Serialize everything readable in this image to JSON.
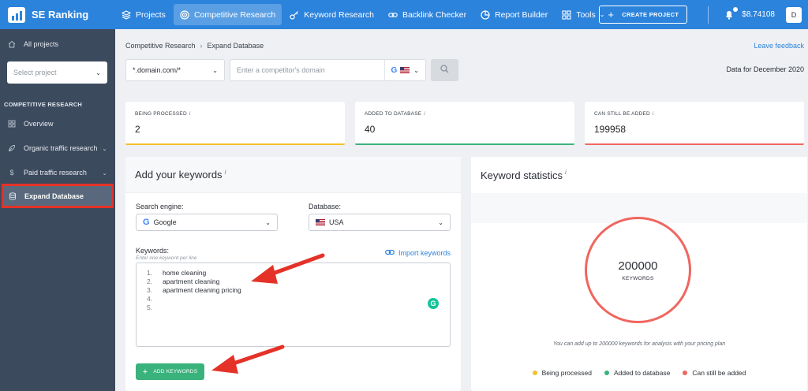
{
  "brand": {
    "name": "SE Ranking"
  },
  "nav": [
    {
      "label": "Projects",
      "icon": "layers-icon"
    },
    {
      "label": "Competitive Research",
      "icon": "target-icon",
      "active": true
    },
    {
      "label": "Keyword Research",
      "icon": "key-icon"
    },
    {
      "label": "Backlink Checker",
      "icon": "link-icon"
    },
    {
      "label": "Report Builder",
      "icon": "report-icon"
    },
    {
      "label": "Tools",
      "icon": "grid-icon",
      "dropdown": true
    }
  ],
  "topright": {
    "create_label": "CREATE PROJECT",
    "balance": "$8.74108",
    "avatar": "D"
  },
  "sidebar": {
    "all_projects": "All projects",
    "select_placeholder": "Select project",
    "section": "COMPETITIVE RESEARCH",
    "items": [
      {
        "label": "Overview"
      },
      {
        "label": "Organic traffic research"
      },
      {
        "label": "Paid traffic research"
      },
      {
        "label": "Expand Database"
      }
    ]
  },
  "breadcrumb": {
    "parent": "Competitive Research",
    "current": "Expand Database"
  },
  "feedback": "Leave feedback",
  "filter": {
    "domain_value": "*.domain.com/*",
    "competitor_placeholder": "Enter a competitor's domain"
  },
  "data_for": "Data for December 2020",
  "stats": [
    {
      "title": "BEING PROCESSED",
      "value": "2"
    },
    {
      "title": "ADDED TO DATABASE",
      "value": "40"
    },
    {
      "title": "CAN STILL BE ADDED",
      "value": "199958"
    }
  ],
  "add_panel": {
    "title": "Add your keywords",
    "engine_label": "Search engine:",
    "engine_value": "Google",
    "db_label": "Database:",
    "db_value": "USA",
    "keywords_label": "Keywords:",
    "keywords_hint": "Enter one keyword per line",
    "import_label": "Import keywords",
    "lines": [
      {
        "n": "1.",
        "text": "home cleaning"
      },
      {
        "n": "2.",
        "text": "apartment cleaning"
      },
      {
        "n": "3.",
        "text": "apartment cleaning pricing"
      },
      {
        "n": "4.",
        "text": ""
      },
      {
        "n": "5.",
        "text": ""
      }
    ],
    "add_label": "ADD KEYWORDS"
  },
  "stats_panel": {
    "title": "Keyword statistics",
    "total": "200000",
    "unit": "KEYWORDS",
    "note": "You can add up to 200000 keywords for analysis with your pricing plan",
    "legend": [
      {
        "label": "Being processed",
        "color": "#f5bf2a"
      },
      {
        "label": "Added to database",
        "color": "#3ab27c"
      },
      {
        "label": "Can still be added",
        "color": "#f0665f"
      }
    ]
  },
  "colors": {
    "accent": "#2c83dc",
    "sidebar": "#3c4a5e",
    "highlight": "#e53228",
    "processing": "#f5bf2a",
    "added": "#3ab27c",
    "remaining": "#f0665f"
  }
}
